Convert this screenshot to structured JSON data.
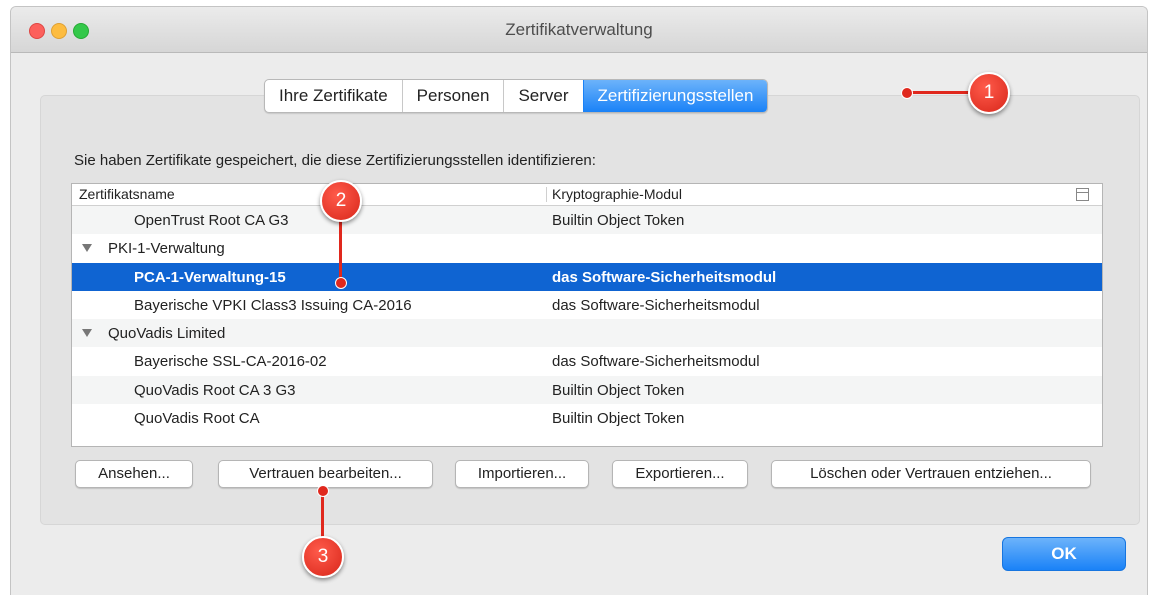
{
  "window": {
    "title": "Zertifikatverwaltung"
  },
  "tabs": [
    {
      "label": "Ihre Zertifikate",
      "active": false
    },
    {
      "label": "Personen",
      "active": false
    },
    {
      "label": "Server",
      "active": false
    },
    {
      "label": "Zertifizierungsstellen",
      "active": true
    }
  ],
  "intro": "Sie haben Zertifikate gespeichert, die diese Zertifizierungsstellen identifizieren:",
  "table": {
    "columns": [
      "Zertifikatsname",
      "Kryptographie-Modul"
    ],
    "rows": [
      {
        "name": "OpenTrust Root CA G3",
        "module": "Builtin Object Token",
        "group": false,
        "selected": false
      },
      {
        "name": "PKI-1-Verwaltung",
        "module": "",
        "group": true,
        "selected": false
      },
      {
        "name": "PCA-1-Verwaltung-15",
        "module": "das Software-Sicherheitsmodul",
        "group": false,
        "selected": true
      },
      {
        "name": "Bayerische VPKI Class3 Issuing CA-2016",
        "module": "das Software-Sicherheitsmodul",
        "group": false,
        "selected": false
      },
      {
        "name": "QuoVadis Limited",
        "module": "",
        "group": true,
        "selected": false
      },
      {
        "name": "Bayerische SSL-CA-2016-02",
        "module": "das Software-Sicherheitsmodul",
        "group": false,
        "selected": false
      },
      {
        "name": "QuoVadis Root CA 3 G3",
        "module": "Builtin Object Token",
        "group": false,
        "selected": false
      },
      {
        "name": "QuoVadis Root CA",
        "module": "Builtin Object Token",
        "group": false,
        "selected": false
      }
    ]
  },
  "buttons": {
    "view": "Ansehen...",
    "edit_trust": "Vertrauen bearbeiten...",
    "import": "Importieren...",
    "export": "Exportieren...",
    "delete": "Löschen oder Vertrauen entziehen...",
    "ok": "OK"
  },
  "markers": [
    "1",
    "2",
    "3"
  ],
  "colors": {
    "accent": "#1a82f7",
    "selection": "#0f64d2",
    "marker": "#e0281d"
  }
}
